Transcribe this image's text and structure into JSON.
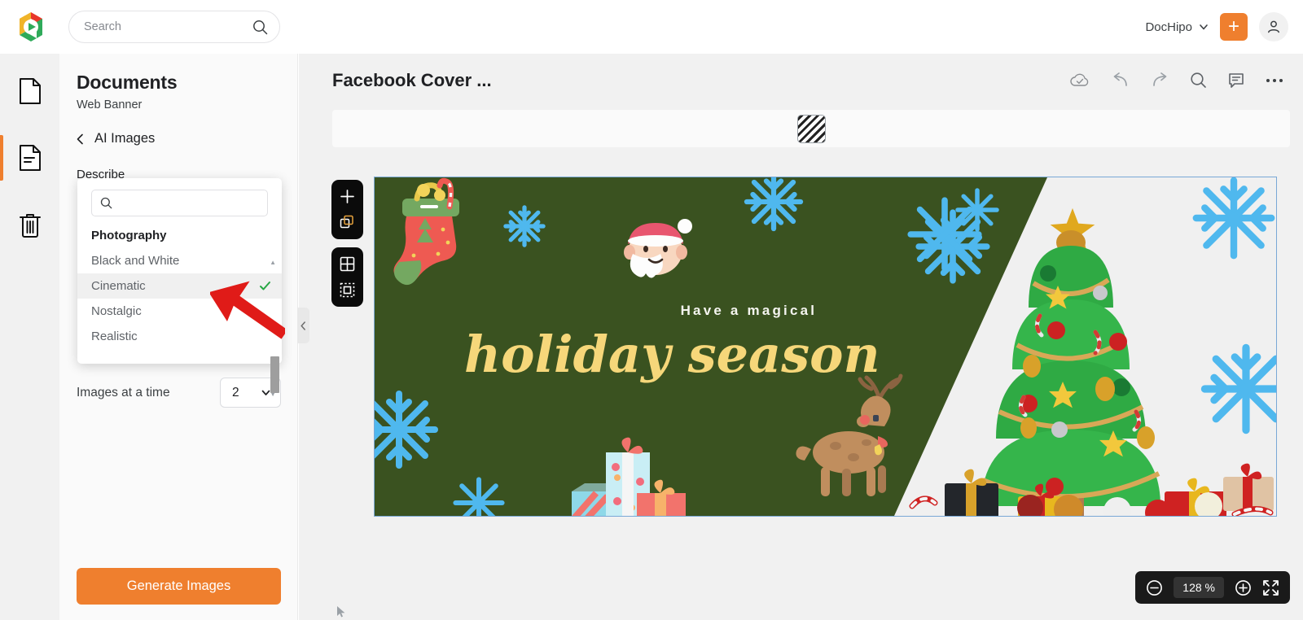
{
  "header": {
    "logo_icon": "dochipo-logo-icon",
    "search": {
      "placeholder": "Search",
      "value": "",
      "icon": "search-icon"
    },
    "brand": {
      "label": "DocHipo",
      "chevron_icon": "chevron-down-icon"
    },
    "add_button": {
      "label": "+",
      "icon": "plus-icon",
      "color": "#ef7f2e"
    },
    "account": {
      "icon": "user-avatar-icon"
    }
  },
  "rail": {
    "items": [
      {
        "name": "blank-page",
        "icon": "page-icon",
        "active": false
      },
      {
        "name": "documents",
        "icon": "document-lines-icon",
        "active": true
      },
      {
        "name": "trash",
        "icon": "trash-icon",
        "active": false
      }
    ],
    "active_indicator_color": "#ef7f2e"
  },
  "panel": {
    "title": "Documents",
    "subtitle": "Web Banner",
    "back": {
      "label": "AI Images",
      "icon": "chevron-left-icon"
    },
    "describe_label": "Describe",
    "images_at_a_time": {
      "label": "Images at a time",
      "value": "2",
      "chevron_icon": "chevron-down-icon"
    },
    "generate_button": {
      "label": "Generate Images",
      "color": "#ef7f2e"
    }
  },
  "dropdown": {
    "search": {
      "placeholder": "",
      "value": "",
      "icon": "search-icon"
    },
    "items": [
      {
        "label": "Photography",
        "type": "group",
        "selected": false
      },
      {
        "label": "Black and White",
        "type": "option",
        "selected": false
      },
      {
        "label": "Cinematic",
        "type": "option",
        "selected": true
      },
      {
        "label": "Nostalgic",
        "type": "option",
        "selected": false
      },
      {
        "label": "Realistic",
        "type": "option",
        "selected": false
      }
    ],
    "check_icon": "check-icon",
    "scroll_up_icon": "caret-up-icon",
    "scroll_down_icon": "caret-down-icon"
  },
  "annotation": {
    "pointer_icon": "red-arrow-pointer",
    "color": "#e01b18"
  },
  "collapse_handle": {
    "icon": "chevron-left-icon"
  },
  "editor": {
    "doc_title": "Facebook Cover ...",
    "actions": [
      {
        "name": "cloud-saved",
        "icon": "cloud-check-icon"
      },
      {
        "name": "undo",
        "icon": "undo-arrow-icon"
      },
      {
        "name": "redo",
        "icon": "redo-arrow-icon"
      },
      {
        "name": "find",
        "icon": "search-icon"
      },
      {
        "name": "comments",
        "icon": "comment-icon"
      },
      {
        "name": "more-options",
        "icon": "ellipsis-icon"
      }
    ],
    "property_bar": {
      "swatch": {
        "name": "transparency-swatch",
        "icon": "checker-pattern-icon"
      }
    },
    "left_tools_top": [
      {
        "name": "add-page",
        "icon": "plus-icon"
      },
      {
        "name": "duplicate-page",
        "icon": "copy-icon"
      }
    ],
    "left_tools_bottom": [
      {
        "name": "grid-view",
        "icon": "grid-icon"
      },
      {
        "name": "select-area",
        "icon": "dashed-square-icon"
      }
    ],
    "zoom": {
      "out_icon": "zoom-out-circle-icon",
      "value": "128 %",
      "in_icon": "zoom-in-circle-icon",
      "fit_icon": "fullscreen-icon"
    }
  },
  "canvas": {
    "background_green": "#3a5220",
    "background_light": "#f0f0f0",
    "heading_small": "Have a magical",
    "heading_script": "holiday season",
    "heading_small_color": "#f5f5f0",
    "heading_script_color": "#f6d77a",
    "decorations": [
      "christmas-stocking",
      "candy-cane",
      "santa-face",
      "snowflake",
      "snowflake",
      "snowflake",
      "snowflake",
      "snowflake",
      "snowflake",
      "snowflake",
      "snowflake",
      "gift-boxes",
      "reindeer",
      "christmas-tree",
      "ornaments"
    ]
  },
  "cursor": {
    "icon": "mouse-pointer-icon"
  }
}
